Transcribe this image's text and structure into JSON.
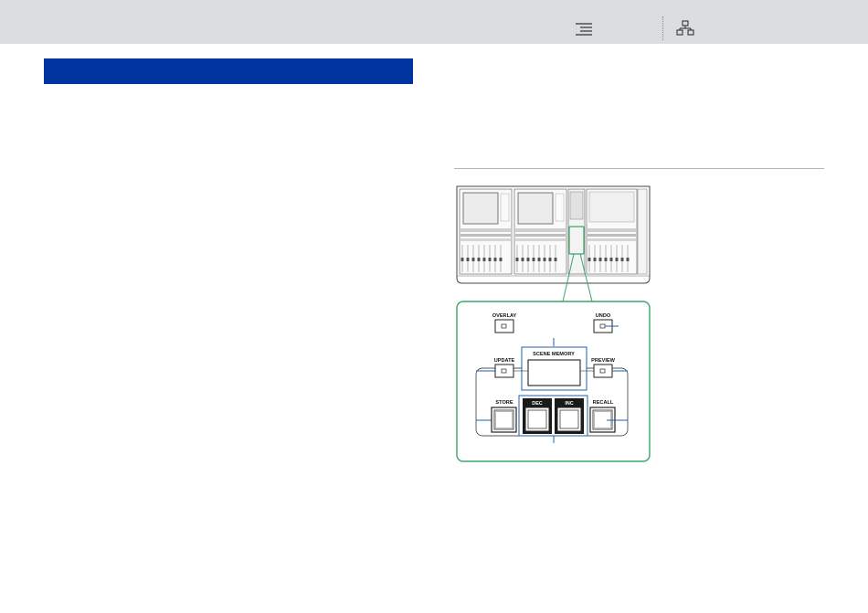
{
  "toolbar": {
    "contents_icon": "table-of-contents-icon",
    "index_icon": "sitemap-icon"
  },
  "colors": {
    "topbar_bg": "#dcdddf",
    "section_bar": "#0033a0",
    "callout_outline": "#3aa66a",
    "callout_lines": "#1f5fa8"
  },
  "panel": {
    "overlay_label": "OVERLAY",
    "undo_label": "UNDO",
    "scene_memory_label": "SCENE MEMORY",
    "update_label": "UPDATE",
    "preview_label": "PREVIEW",
    "store_label": "STORE",
    "dec_label": "DEC",
    "inc_label": "INC",
    "recall_label": "RECALL"
  }
}
